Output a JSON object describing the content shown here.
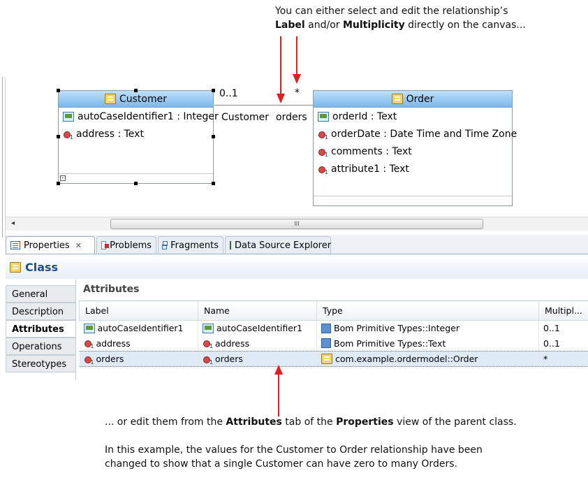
{
  "annotations": {
    "top_line1": "You can either select and edit the relationship’s",
    "top_label_word": "Label",
    "top_and_or": " and/or ",
    "top_multiplicity_word": "Multiplicity",
    "top_rest": " directly on the canvas...",
    "bottom_pre": "... or edit them from the ",
    "bottom_attributes_word": "Attributes",
    "bottom_mid": " tab of the ",
    "bottom_properties_word": "Properties",
    "bottom_post": " view of the parent class.",
    "bottom_line2": "In this example, the values for the Customer to Order relationship have  been",
    "bottom_line3": "changed to show that a single Customer can have zero to many Orders."
  },
  "diagram": {
    "customer": {
      "title": "Customer",
      "attributes": [
        {
          "icon": "identifier-attribute-icon",
          "text": "autoCaseIdentifier1 : Integer"
        },
        {
          "icon": "attribute-icon",
          "text": "address : Text"
        }
      ]
    },
    "order": {
      "title": "Order",
      "attributes": [
        {
          "icon": "identifier-attribute-icon",
          "text": "orderId : Text"
        },
        {
          "icon": "attribute-icon",
          "text": "orderDate : Date Time and Time Zone"
        },
        {
          "icon": "attribute-icon",
          "text": "comments : Text"
        },
        {
          "icon": "attribute-icon",
          "text": "attribute1 : Text"
        }
      ]
    },
    "relationship": {
      "source_multiplicity": "0..1",
      "target_multiplicity": "*",
      "source_role": "Customer",
      "target_role": "orders"
    }
  },
  "scrollbar": {
    "left_arrow": "◂",
    "thumb_grip": "III"
  },
  "tabs": [
    {
      "label": "Properties",
      "icon": "properties-icon",
      "active": true,
      "close": "✕"
    },
    {
      "label": "Problems",
      "icon": "problems-icon",
      "active": false
    },
    {
      "label": "Fragments",
      "icon": "fragments-icon",
      "active": false
    },
    {
      "label": "Data Source Explorer",
      "icon": "data-source-icon",
      "active": false
    }
  ],
  "properties": {
    "title": "Class",
    "side_tabs": [
      "General",
      "Description",
      "Attributes",
      "Operations",
      "Stereotypes"
    ],
    "active_side_tab": "Attributes",
    "section_heading": "Attributes",
    "columns": [
      "Label",
      "Name",
      "Type",
      "Multipl..."
    ],
    "rows": [
      {
        "label": "autoCaseIdentifier1",
        "name": "autoCaseIdentifier1",
        "type": "Bom Primitive Types::Integer",
        "multiplicity": "0..1",
        "selected": false
      },
      {
        "label": "address",
        "name": "address",
        "type": "Bom Primitive Types::Text",
        "multiplicity": "0..1",
        "selected": false
      },
      {
        "label": "orders",
        "name": "orders",
        "type": "com.example.ordermodel::Order",
        "multiplicity": "*",
        "selected": true
      }
    ]
  },
  "colors": {
    "accent_arrow": "#e02020",
    "class_header": "#7ab8ec",
    "title_blue": "#1d4f84"
  }
}
